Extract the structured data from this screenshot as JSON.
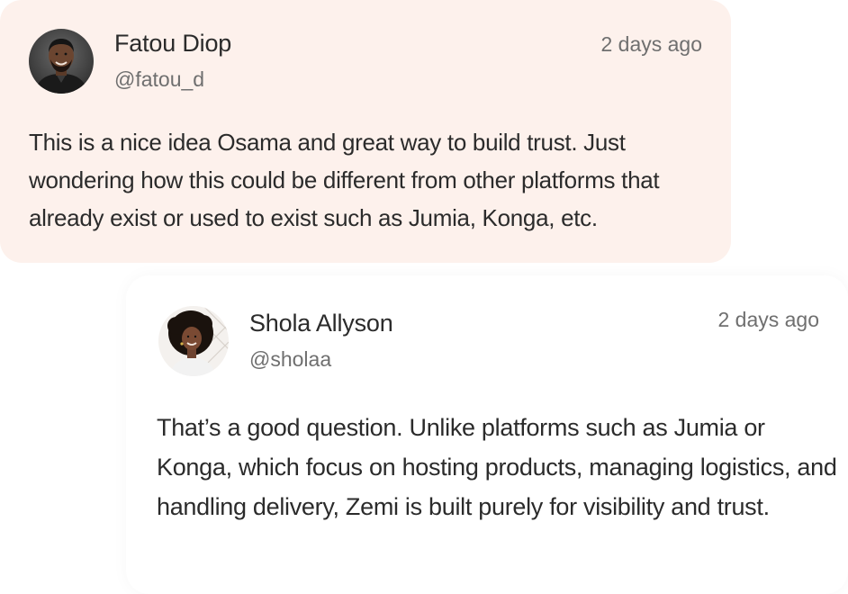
{
  "comments": [
    {
      "author_name": "Fatou Diop",
      "author_handle": "@fatou_d",
      "timestamp": "2 days ago",
      "avatar_icon": "avatar-photo-man",
      "background_color": "#fdf1ec",
      "body": "This is a nice idea Osama and great way to build trust. Just wondering how this could be different from other platforms that already exist or used to exist such as Jumia, Konga, etc."
    },
    {
      "author_name": "Shola Allyson",
      "author_handle": "@sholaa",
      "timestamp": "2 days ago",
      "avatar_icon": "avatar-photo-woman",
      "background_color": "#ffffff",
      "body": "That’s a good question. Unlike platforms such as Jumia or Konga, which focus on hosting products, managing logistics, and handling delivery, Zemi is built purely for visibility and trust."
    }
  ]
}
